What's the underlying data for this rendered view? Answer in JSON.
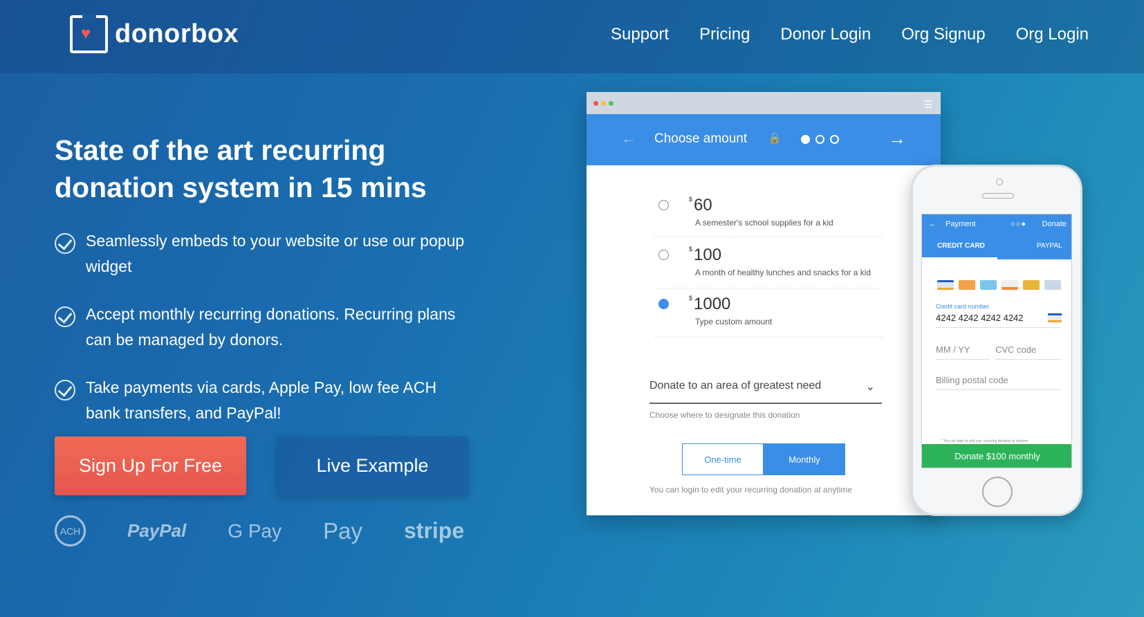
{
  "header": {
    "logo_text": "donorbox",
    "nav": [
      "Support",
      "Pricing",
      "Donor Login",
      "Org Signup",
      "Org Login"
    ]
  },
  "hero": {
    "title": "State of the art recurring donation system in 15 mins",
    "features": [
      "Seamlessly embeds to your website or use our popup widget",
      "Accept monthly recurring donations. Recurring plans can be managed by donors.",
      "Take payments via cards, Apple Pay, low fee ACH bank transfers, and PayPal!"
    ],
    "signup_label": "Sign Up For Free",
    "live_label": "Live Example"
  },
  "payment_methods": [
    "ACH",
    "PayPal",
    "G Pay",
    " Pay",
    "stripe"
  ],
  "widget": {
    "step_title": "Choose amount",
    "amounts": [
      {
        "currency": "$",
        "value": "60",
        "desc": "A semester's school supplies for a kid",
        "selected": false
      },
      {
        "currency": "$",
        "value": "100",
        "desc": "A month of healthy lunches and snacks for a kid",
        "selected": false
      },
      {
        "currency": "$",
        "value": "1000",
        "desc": "Type custom amount",
        "selected": true
      }
    ],
    "designation": "Donate to an area of greatest need",
    "designation_help": "Choose where to designate this donation",
    "freq_one": "One-time",
    "freq_monthly": "Monthly",
    "login_note": "You can login to edit your recurring donation at anytime"
  },
  "phone": {
    "title": "Payment",
    "donate_link": "Donate",
    "tab_card": "CREDIT CARD",
    "tab_paypal": "PAYPAL",
    "card_label": "Credit card number",
    "card_number": "4242 4242 4242 4242",
    "expiry_placeholder": "MM / YY",
    "cvc_placeholder": "CVC code",
    "postal_placeholder": "Billing postal code",
    "note": "* You can login to edit your recurring donation at anytime",
    "donate_button": "Donate $100 monthly"
  },
  "colors": {
    "signup_button": "#e95c4f",
    "accent_blue": "#3a8ee6",
    "donate_green": "#2cb35a"
  }
}
